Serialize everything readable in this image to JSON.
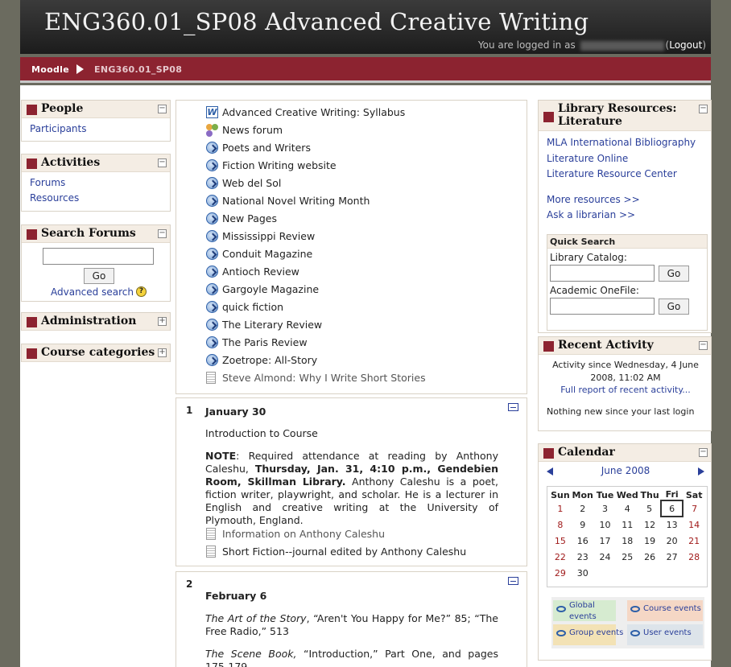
{
  "header": {
    "course_title": "ENG360.01_SP08 Advanced Creative Writing",
    "logged_in_prefix": "You are logged in as",
    "logout_label": "Logout"
  },
  "navbar": {
    "home": "Moodle",
    "course": "ENG360.01_SP08"
  },
  "left": {
    "people": {
      "title": "People",
      "items": [
        "Participants"
      ]
    },
    "activities": {
      "title": "Activities",
      "items": [
        "Forums",
        "Resources"
      ]
    },
    "search": {
      "title": "Search Forums",
      "go": "Go",
      "advanced": "Advanced search"
    },
    "administration": {
      "title": "Administration"
    },
    "categories": {
      "title": "Course categories"
    }
  },
  "resources": [
    {
      "label": "Advanced Creative Writing: Syllabus",
      "icon": "word-doc-icon"
    },
    {
      "label": "News forum",
      "icon": "forum-icon"
    },
    {
      "label": "Poets and Writers",
      "icon": "web-link-icon"
    },
    {
      "label": "Fiction Writing website",
      "icon": "web-link-icon"
    },
    {
      "label": "Web del Sol",
      "icon": "web-link-icon"
    },
    {
      "label": "National Novel Writing Month",
      "icon": "web-link-icon"
    },
    {
      "label": "New Pages",
      "icon": "web-link-icon"
    },
    {
      "label": "Mississippi Review",
      "icon": "web-link-icon"
    },
    {
      "label": "Conduit Magazine",
      "icon": "web-link-icon"
    },
    {
      "label": "Antioch Review",
      "icon": "web-link-icon"
    },
    {
      "label": "Gargoyle Magazine",
      "icon": "web-link-icon"
    },
    {
      "label": "quick fiction",
      "icon": "web-link-icon"
    },
    {
      "label": "The Literary Review",
      "icon": "web-link-icon"
    },
    {
      "label": "The Paris Review",
      "icon": "web-link-icon"
    },
    {
      "label": "Zoetrope: All-Story",
      "icon": "web-link-icon"
    },
    {
      "label": "Steve Almond: Why I Write Short Stories",
      "icon": "text-page-icon"
    }
  ],
  "topic1": {
    "num": "1",
    "date": "January 30",
    "intro": "Introduction to Course",
    "note_label": "NOTE",
    "note_a": ": Required attendance at reading by Anthony Caleshu, ",
    "note_bold": "Thursday, Jan. 31, 4:10 p.m., Gendebien Room, Skillman Library.",
    "note_b": " Anthony Caleshu is a poet, fiction writer, playwright, and scholar. He is a lecturer in English and creative writing at the University of Plymouth, England.",
    "res1": "Information on Anthony Caleshu",
    "res2": "Short Fiction--journal edited by Anthony Caleshu"
  },
  "topic2": {
    "num": "2",
    "date": "February 6",
    "p1_italic": "The Art of the Story",
    "p1_rest": ", “Aren't You Happy for Me?” 85; “The Free Radio,” 513",
    "p2_italic": "The Scene Book,",
    "p2_rest": " “Introduction,” Part One, and pages 175-179"
  },
  "right": {
    "library": {
      "title": "Library Resources: Literature",
      "links": [
        "MLA International Bibliography",
        "Literature Online",
        "Literature Resource Center"
      ],
      "more": "More resources >>",
      "ask": "Ask a librarian >>",
      "qs_title": "Quick Search",
      "catalog_label": "Library Catalog:",
      "onefile_label": "Academic OneFile:",
      "go": "Go"
    },
    "recent": {
      "title": "Recent Activity",
      "since": "Activity since Wednesday, 4 June 2008, 11:02 AM",
      "full": "Full report of recent activity...",
      "nothing": "Nothing new since your last login"
    },
    "calendar": {
      "title": "Calendar",
      "month": "June 2008",
      "days": [
        "Sun",
        "Mon",
        "Tue",
        "Wed",
        "Thu",
        "Fri",
        "Sat"
      ],
      "weeks": [
        [
          "1",
          "2",
          "3",
          "4",
          "5",
          "6",
          "7"
        ],
        [
          "8",
          "9",
          "10",
          "11",
          "12",
          "13",
          "14"
        ],
        [
          "15",
          "16",
          "17",
          "18",
          "19",
          "20",
          "21"
        ],
        [
          "22",
          "23",
          "24",
          "25",
          "26",
          "27",
          "28"
        ],
        [
          "29",
          "30",
          "",
          "",
          "",
          "",
          ""
        ]
      ],
      "today": "6",
      "legend": {
        "global": "Global events",
        "course": "Course events",
        "group": "Group events",
        "user": "User events"
      },
      "colors": {
        "weekend": "#a01b1b",
        "global": "#d6ebd0",
        "course": "#f5d7c5",
        "group": "#f3e2b5",
        "user": "#dde4ea"
      }
    }
  }
}
